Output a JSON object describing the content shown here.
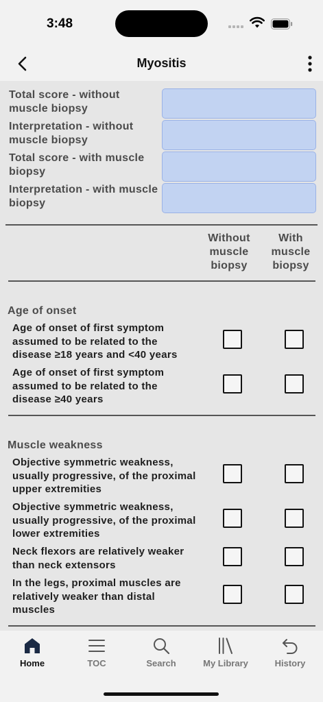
{
  "status_bar": {
    "time": "3:48"
  },
  "nav": {
    "title": "Myositis",
    "back_icon": "chevron-left-icon",
    "more_icon": "more-vertical-icon"
  },
  "summary": [
    {
      "label": "Total score - without muscle biopsy",
      "value": ""
    },
    {
      "label": "Interpretation - without muscle biopsy",
      "value": ""
    },
    {
      "label": "Total score - with muscle biopsy",
      "value": ""
    },
    {
      "label": "Interpretation - with muscle biopsy",
      "value": ""
    }
  ],
  "columns": {
    "without": "Without muscle biopsy",
    "with": "With muscle biopsy"
  },
  "sections": [
    {
      "title": "Age of onset",
      "criteria": [
        {
          "text": "Age of onset of first symptom assumed to be related to the disease ≥18 years and <40 years",
          "without_checked": false,
          "with_checked": false
        },
        {
          "text": "Age of onset of first symptom assumed to be related to the disease ≥40 years",
          "without_checked": false,
          "with_checked": false
        }
      ]
    },
    {
      "title": "Muscle weakness",
      "criteria": [
        {
          "text": "Objective symmetric weakness, usually progressive, of the proximal upper extremities",
          "without_checked": false,
          "with_checked": false
        },
        {
          "text": "Objective symmetric weakness, usually progressive, of the proximal lower extremities",
          "without_checked": false,
          "with_checked": false
        },
        {
          "text": "Neck flexors are relatively weaker than neck extensors",
          "without_checked": false,
          "with_checked": false
        },
        {
          "text": "In the legs, proximal muscles are relatively weaker than distal muscles",
          "without_checked": false,
          "with_checked": false
        }
      ]
    }
  ],
  "tabs": [
    {
      "label": "Home",
      "icon": "home-icon",
      "active": true
    },
    {
      "label": "TOC",
      "icon": "menu-icon",
      "active": false
    },
    {
      "label": "Search",
      "icon": "search-icon",
      "active": false
    },
    {
      "label": "My Library",
      "icon": "library-icon",
      "active": false
    },
    {
      "label": "History",
      "icon": "history-icon",
      "active": false
    }
  ]
}
